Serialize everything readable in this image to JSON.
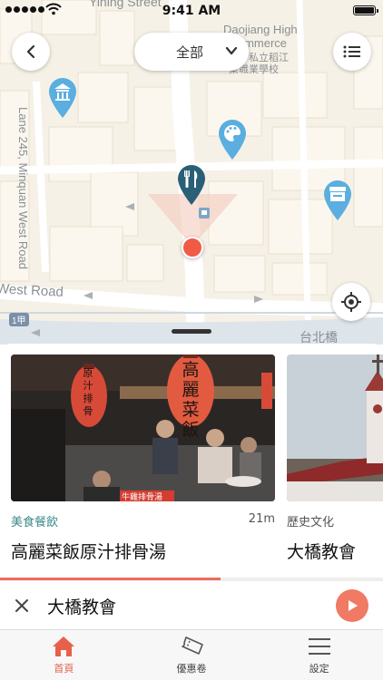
{
  "status_bar": {
    "time": "9:41 AM"
  },
  "top_bar": {
    "category_label": "全部"
  },
  "map": {
    "labels": {
      "top_street": "Yining Street",
      "school_en_1": "Daojiang High",
      "school_en_2": "of Commerce",
      "school_zh_1": "私立稻江",
      "school_zh_2": "業職業學校",
      "lane": "Lane 245, Minquan West Road",
      "west_road": "West Road",
      "bridge": "台北橋",
      "route_badge": "1甲"
    },
    "pin_icons": [
      "temple-icon",
      "palette-icon",
      "fork-knife-icon",
      "shop-icon"
    ],
    "pin_color": "#5aaee0",
    "selected_pin_color": "#2a5f78",
    "user_dot_color": "#ef5b45"
  },
  "cards": [
    {
      "category": "美食餐飲",
      "distance": "21m",
      "title": "高麗菜飯原汁排骨湯"
    },
    {
      "category": "歷史文化",
      "distance": "",
      "title": "大橋教會"
    }
  ],
  "photo_signs": {
    "lantern_main": "高麗菜飯",
    "lantern_left": "原汁排骨",
    "banner": "牛雞排骨湯"
  },
  "player": {
    "progress": 0.575,
    "now_playing": "大橋教會"
  },
  "tabs": [
    {
      "label": "首頁",
      "icon": "home-icon",
      "active": true
    },
    {
      "label": "優惠卷",
      "icon": "ticket-icon",
      "active": false
    },
    {
      "label": "設定",
      "icon": "menu-icon",
      "active": false
    }
  ],
  "colors": {
    "accent": "#ee6b5e",
    "category_teal": "#3d8a8a"
  }
}
